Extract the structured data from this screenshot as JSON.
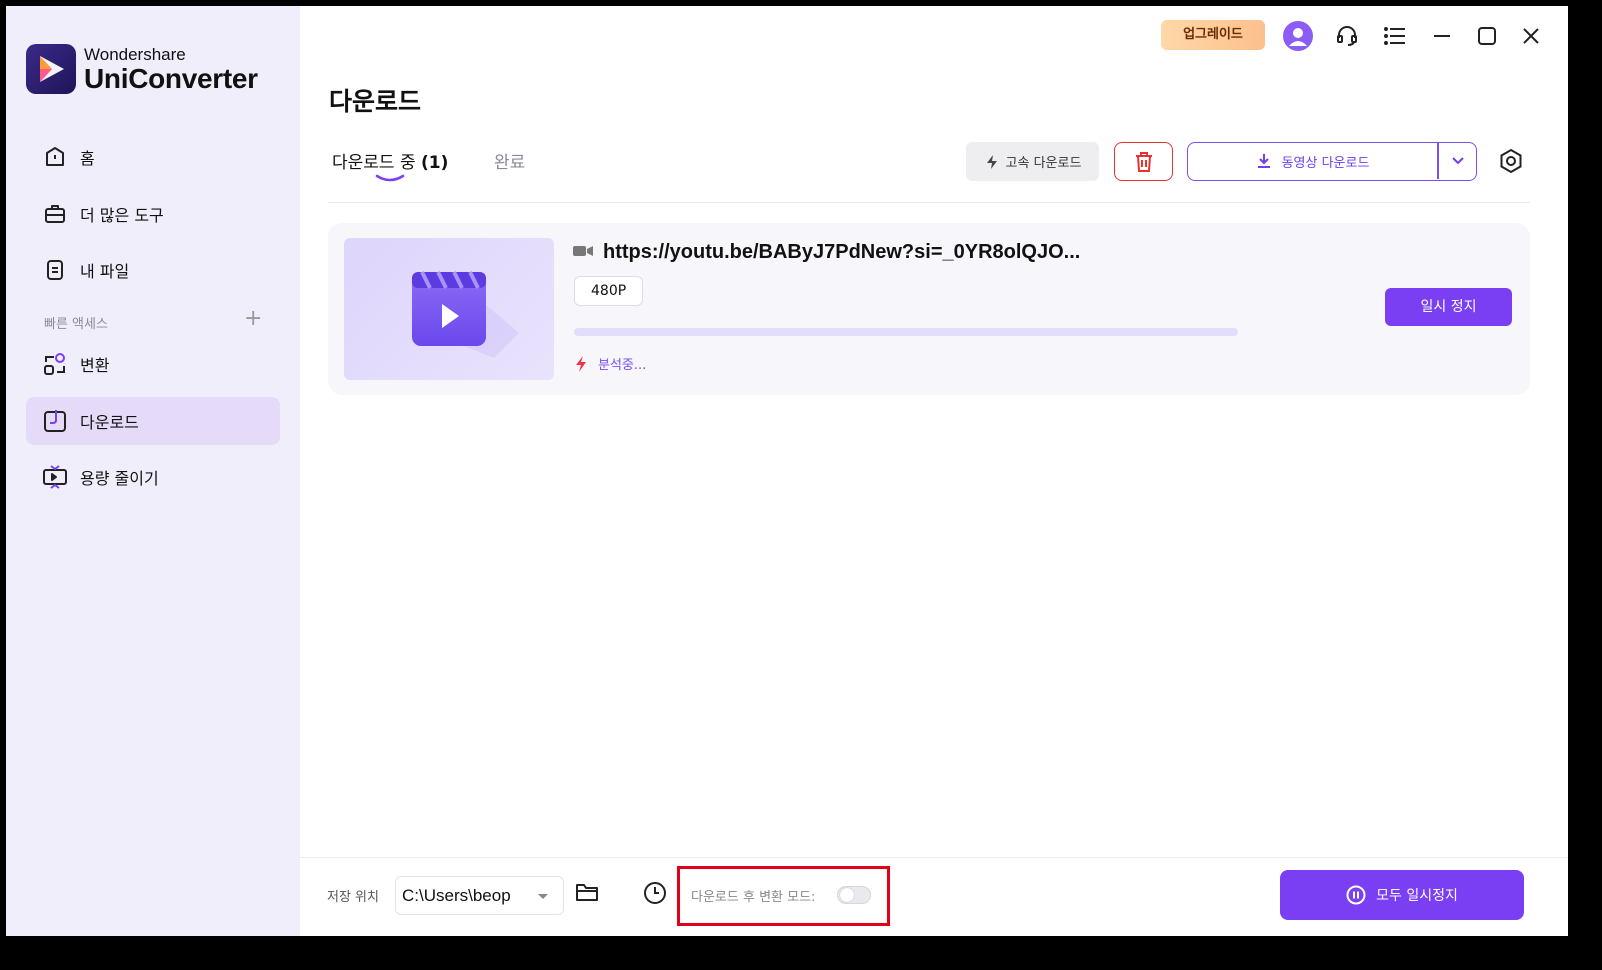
{
  "app": {
    "brand": "Wondershare",
    "product": "UniConverter"
  },
  "sidebar": {
    "items": [
      {
        "label": "홈",
        "icon": "home-icon"
      },
      {
        "label": "더 많은 도구",
        "icon": "toolbox-icon"
      },
      {
        "label": "내 파일",
        "icon": "file-icon"
      }
    ],
    "quick_access_label": "빠른 액세스",
    "quick_items": [
      {
        "label": "변환",
        "icon": "convert-icon"
      },
      {
        "label": "다운로드",
        "icon": "download-icon",
        "active": true
      },
      {
        "label": "용량 줄이기",
        "icon": "compress-icon"
      }
    ]
  },
  "topbar": {
    "upgrade_label": "업그레이드"
  },
  "page": {
    "title": "다운로드",
    "tabs": {
      "downloading_label": "다운로드 중",
      "downloading_count": "(1)",
      "done_label": "완료"
    },
    "toolbar": {
      "fast_download_label": "고속 다운로드",
      "video_download_label": "동영상 다운로드"
    }
  },
  "download_item": {
    "url": "https://youtu.be/BAByJ7PdNew?si=_0YR8olQJO...",
    "quality": "480P",
    "status": "분석중...",
    "pause_label": "일시 정지",
    "progress": 0
  },
  "bottombar": {
    "save_location_label": "저장 위치",
    "save_path": "C:\\Users\\beop",
    "convert_mode_label": "다운로드 후 변환 모드:",
    "convert_mode_on": false,
    "pause_all_label": "모두 일시정지"
  },
  "colors": {
    "accent": "#7a3ff2",
    "sidebar_bg": "#f1eefb",
    "active_nav_bg": "#e5dbf8",
    "delete_red": "#e3342f",
    "highlight_box": "#e0001a"
  }
}
